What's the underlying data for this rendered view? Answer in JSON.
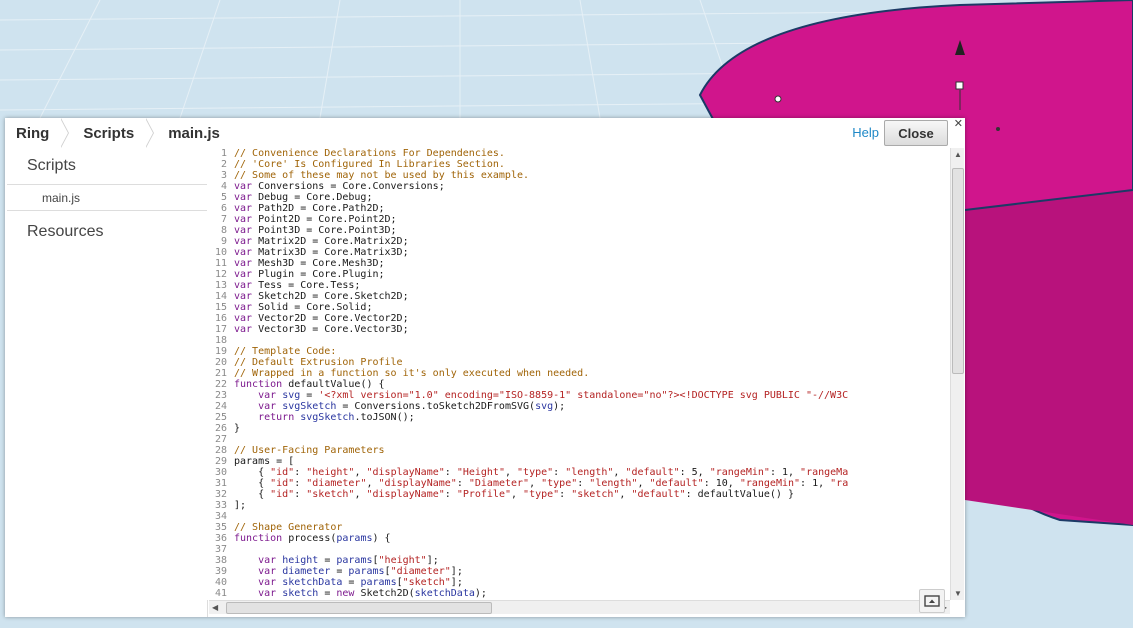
{
  "breadcrumb": [
    "Ring",
    "Scripts",
    "main.js"
  ],
  "header": {
    "help_label": "Help",
    "close_label": "Close"
  },
  "sidebar": {
    "scripts_heading": "Scripts",
    "file_item": "main.js",
    "resources_heading": "Resources"
  },
  "colors": {
    "workspace": "#cfe3ef",
    "ring": "#d0158c",
    "accent_link": "#1e88c7"
  },
  "icons": [
    "close-icon",
    "collapse-panel-icon",
    "scroll-up-arrow-icon",
    "scroll-down-arrow-icon",
    "scroll-left-arrow-icon",
    "scroll-right-arrow-icon"
  ],
  "code_lines": [
    [
      [
        "c",
        "// Convenience Declarations For Dependencies."
      ]
    ],
    [
      [
        "c",
        "// 'Core' Is Configured In Libraries Section."
      ]
    ],
    [
      [
        "c",
        "// Some of these may not be used by this example."
      ]
    ],
    [
      [
        "k",
        "var"
      ],
      [
        "t",
        " Conversions = Core.Conversions;"
      ]
    ],
    [
      [
        "k",
        "var"
      ],
      [
        "t",
        " Debug = Core.Debug;"
      ]
    ],
    [
      [
        "k",
        "var"
      ],
      [
        "t",
        " Path2D = Core.Path2D;"
      ]
    ],
    [
      [
        "k",
        "var"
      ],
      [
        "t",
        " Point2D = Core.Point2D;"
      ]
    ],
    [
      [
        "k",
        "var"
      ],
      [
        "t",
        " Point3D = Core.Point3D;"
      ]
    ],
    [
      [
        "k",
        "var"
      ],
      [
        "t",
        " Matrix2D = Core.Matrix2D;"
      ]
    ],
    [
      [
        "k",
        "var"
      ],
      [
        "t",
        " Matrix3D = Core.Matrix3D;"
      ]
    ],
    [
      [
        "k",
        "var"
      ],
      [
        "t",
        " Mesh3D = Core.Mesh3D;"
      ]
    ],
    [
      [
        "k",
        "var"
      ],
      [
        "t",
        " Plugin = Core.Plugin;"
      ]
    ],
    [
      [
        "k",
        "var"
      ],
      [
        "t",
        " Tess = Core.Tess;"
      ]
    ],
    [
      [
        "k",
        "var"
      ],
      [
        "t",
        " Sketch2D = Core.Sketch2D;"
      ]
    ],
    [
      [
        "k",
        "var"
      ],
      [
        "t",
        " Solid = Core.Solid;"
      ]
    ],
    [
      [
        "k",
        "var"
      ],
      [
        "t",
        " Vector2D = Core.Vector2D;"
      ]
    ],
    [
      [
        "k",
        "var"
      ],
      [
        "t",
        " Vector3D = Core.Vector3D;"
      ]
    ],
    [
      [
        "t",
        ""
      ]
    ],
    [
      [
        "c",
        "// Template Code:"
      ]
    ],
    [
      [
        "c",
        "// Default Extrusion Profile"
      ]
    ],
    [
      [
        "c",
        "// Wrapped in a function so it's only executed when needed."
      ]
    ],
    [
      [
        "k",
        "function"
      ],
      [
        "t",
        " defaultValue() {"
      ]
    ],
    [
      [
        "t",
        "    "
      ],
      [
        "k",
        "var"
      ],
      [
        "t",
        " "
      ],
      [
        "v",
        "svg"
      ],
      [
        "t",
        " = "
      ],
      [
        "s",
        "'<?xml version=\"1.0\" encoding=\"ISO-8859-1\" standalone=\"no\"?><!DOCTYPE svg PUBLIC \"-//W3C"
      ]
    ],
    [
      [
        "t",
        "    "
      ],
      [
        "k",
        "var"
      ],
      [
        "t",
        " "
      ],
      [
        "v",
        "svgSketch"
      ],
      [
        "t",
        " = Conversions.toSketch2DFromSVG("
      ],
      [
        "v",
        "svg"
      ],
      [
        "t",
        ");"
      ]
    ],
    [
      [
        "t",
        "    "
      ],
      [
        "k",
        "return"
      ],
      [
        "t",
        " "
      ],
      [
        "v",
        "svgSketch"
      ],
      [
        "t",
        ".toJSON();"
      ]
    ],
    [
      [
        "t",
        "}"
      ]
    ],
    [
      [
        "t",
        ""
      ]
    ],
    [
      [
        "c",
        "// User-Facing Parameters"
      ]
    ],
    [
      [
        "t",
        "params = ["
      ]
    ],
    [
      [
        "t",
        "    { "
      ],
      [
        "s",
        "\"id\""
      ],
      [
        "t",
        ": "
      ],
      [
        "s",
        "\"height\""
      ],
      [
        "t",
        ", "
      ],
      [
        "s",
        "\"displayName\""
      ],
      [
        "t",
        ": "
      ],
      [
        "s",
        "\"Height\""
      ],
      [
        "t",
        ", "
      ],
      [
        "s",
        "\"type\""
      ],
      [
        "t",
        ": "
      ],
      [
        "s",
        "\"length\""
      ],
      [
        "t",
        ", "
      ],
      [
        "s",
        "\"default\""
      ],
      [
        "t",
        ": 5, "
      ],
      [
        "s",
        "\"rangeMin\""
      ],
      [
        "t",
        ": 1, "
      ],
      [
        "s",
        "\"rangeMa"
      ]
    ],
    [
      [
        "t",
        "    { "
      ],
      [
        "s",
        "\"id\""
      ],
      [
        "t",
        ": "
      ],
      [
        "s",
        "\"diameter\""
      ],
      [
        "t",
        ", "
      ],
      [
        "s",
        "\"displayName\""
      ],
      [
        "t",
        ": "
      ],
      [
        "s",
        "\"Diameter\""
      ],
      [
        "t",
        ", "
      ],
      [
        "s",
        "\"type\""
      ],
      [
        "t",
        ": "
      ],
      [
        "s",
        "\"length\""
      ],
      [
        "t",
        ", "
      ],
      [
        "s",
        "\"default\""
      ],
      [
        "t",
        ": 10, "
      ],
      [
        "s",
        "\"rangeMin\""
      ],
      [
        "t",
        ": 1, "
      ],
      [
        "s",
        "\"ra"
      ]
    ],
    [
      [
        "t",
        "    { "
      ],
      [
        "s",
        "\"id\""
      ],
      [
        "t",
        ": "
      ],
      [
        "s",
        "\"sketch\""
      ],
      [
        "t",
        ", "
      ],
      [
        "s",
        "\"displayName\""
      ],
      [
        "t",
        ": "
      ],
      [
        "s",
        "\"Profile\""
      ],
      [
        "t",
        ", "
      ],
      [
        "s",
        "\"type\""
      ],
      [
        "t",
        ": "
      ],
      [
        "s",
        "\"sketch\""
      ],
      [
        "t",
        ", "
      ],
      [
        "s",
        "\"default\""
      ],
      [
        "t",
        ": defaultValue() }"
      ]
    ],
    [
      [
        "t",
        "];"
      ]
    ],
    [
      [
        "t",
        ""
      ]
    ],
    [
      [
        "c",
        "// Shape Generator"
      ]
    ],
    [
      [
        "k",
        "function"
      ],
      [
        "t",
        " process("
      ],
      [
        "v",
        "params"
      ],
      [
        "t",
        ") {"
      ]
    ],
    [
      [
        "t",
        ""
      ]
    ],
    [
      [
        "t",
        "    "
      ],
      [
        "k",
        "var"
      ],
      [
        "t",
        " "
      ],
      [
        "v",
        "height"
      ],
      [
        "t",
        " = "
      ],
      [
        "v",
        "params"
      ],
      [
        "t",
        "["
      ],
      [
        "s",
        "\"height\""
      ],
      [
        "t",
        "];"
      ]
    ],
    [
      [
        "t",
        "    "
      ],
      [
        "k",
        "var"
      ],
      [
        "t",
        " "
      ],
      [
        "v",
        "diameter"
      ],
      [
        "t",
        " = "
      ],
      [
        "v",
        "params"
      ],
      [
        "t",
        "["
      ],
      [
        "s",
        "\"diameter\""
      ],
      [
        "t",
        "];"
      ]
    ],
    [
      [
        "t",
        "    "
      ],
      [
        "k",
        "var"
      ],
      [
        "t",
        " "
      ],
      [
        "v",
        "sketchData"
      ],
      [
        "t",
        " = "
      ],
      [
        "v",
        "params"
      ],
      [
        "t",
        "["
      ],
      [
        "s",
        "\"sketch\""
      ],
      [
        "t",
        "];"
      ]
    ],
    [
      [
        "t",
        "    "
      ],
      [
        "k",
        "var"
      ],
      [
        "t",
        " "
      ],
      [
        "v",
        "sketch"
      ],
      [
        "t",
        " = "
      ],
      [
        "k",
        "new"
      ],
      [
        "t",
        " Sketch2D("
      ],
      [
        "v",
        "sketchData"
      ],
      [
        "t",
        ");"
      ]
    ]
  ]
}
